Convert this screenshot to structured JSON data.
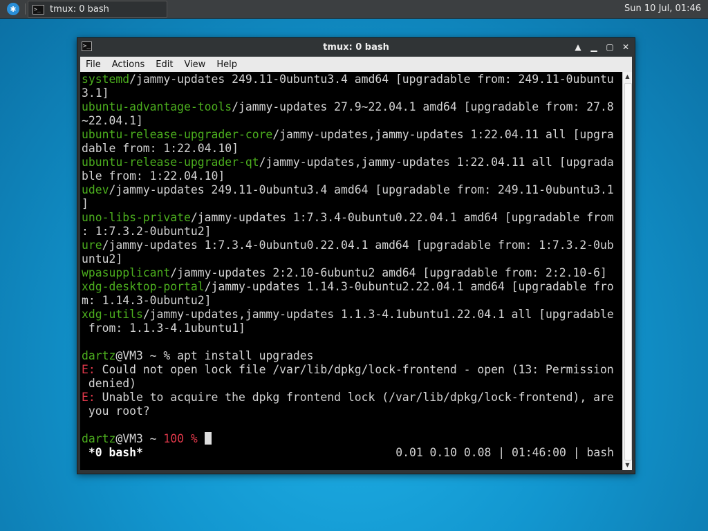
{
  "panel": {
    "task_title": "tmux: 0 bash",
    "clock": "Sun 10 Jul, 01:46"
  },
  "window": {
    "title": "tmux: 0 bash",
    "menu": [
      "File",
      "Actions",
      "Edit",
      "View",
      "Help"
    ]
  },
  "terminal": {
    "lines": [
      {
        "pkg": "systemd",
        "rest": "/jammy-updates 249.11-0ubuntu3.4 amd64 [upgradable from: 249.11-0ubuntu"
      },
      {
        "pkg": "",
        "rest": "3.1]"
      },
      {
        "pkg": "ubuntu-advantage-tools",
        "rest": "/jammy-updates 27.9~22.04.1 amd64 [upgradable from: 27.8"
      },
      {
        "pkg": "",
        "rest": "~22.04.1]"
      },
      {
        "pkg": "ubuntu-release-upgrader-core",
        "rest": "/jammy-updates,jammy-updates 1:22.04.11 all [upgra"
      },
      {
        "pkg": "",
        "rest": "dable from: 1:22.04.10]"
      },
      {
        "pkg": "ubuntu-release-upgrader-qt",
        "rest": "/jammy-updates,jammy-updates 1:22.04.11 all [upgrada"
      },
      {
        "pkg": "",
        "rest": "ble from: 1:22.04.10]"
      },
      {
        "pkg": "udev",
        "rest": "/jammy-updates 249.11-0ubuntu3.4 amd64 [upgradable from: 249.11-0ubuntu3.1"
      },
      {
        "pkg": "",
        "rest": "]"
      },
      {
        "pkg": "uno-libs-private",
        "rest": "/jammy-updates 1:7.3.4-0ubuntu0.22.04.1 amd64 [upgradable from"
      },
      {
        "pkg": "",
        "rest": ": 1:7.3.2-0ubuntu2]"
      },
      {
        "pkg": "ure",
        "rest": "/jammy-updates 1:7.3.4-0ubuntu0.22.04.1 amd64 [upgradable from: 1:7.3.2-0ub"
      },
      {
        "pkg": "",
        "rest": "untu2]"
      },
      {
        "pkg": "wpasupplicant",
        "rest": "/jammy-updates 2:2.10-6ubuntu2 amd64 [upgradable from: 2:2.10-6]"
      },
      {
        "pkg": "xdg-desktop-portal",
        "rest": "/jammy-updates 1.14.3-0ubuntu2.22.04.1 amd64 [upgradable fro"
      },
      {
        "pkg": "",
        "rest": "m: 1.14.3-0ubuntu2]"
      },
      {
        "pkg": "xdg-utils",
        "rest": "/jammy-updates,jammy-updates 1.1.3-4.1ubuntu1.22.04.1 all [upgradable"
      },
      {
        "pkg": "",
        "rest": " from: 1.1.3-4.1ubuntu1]"
      }
    ],
    "prompt1": {
      "user": "dartz",
      "host": "@VM3 ~ % ",
      "cmd": "apt install upgrades"
    },
    "errors": [
      {
        "tag": "E:",
        "text": " Could not open lock file /var/lib/dpkg/lock-frontend - open (13: Permission"
      },
      {
        "tag": "",
        "text": " denied)"
      },
      {
        "tag": "E:",
        "text": " Unable to acquire the dpkg frontend lock (/var/lib/dpkg/lock-frontend), are"
      },
      {
        "tag": "",
        "text": " you root?"
      }
    ],
    "prompt2": {
      "user": "dartz",
      "host": "@VM3 ~ ",
      "status": "100 %",
      "trail": " "
    },
    "statusbar": {
      "left": " *0 bash*",
      "right": "0.01 0.10 0.08 | 01:46:00 | bash"
    }
  }
}
